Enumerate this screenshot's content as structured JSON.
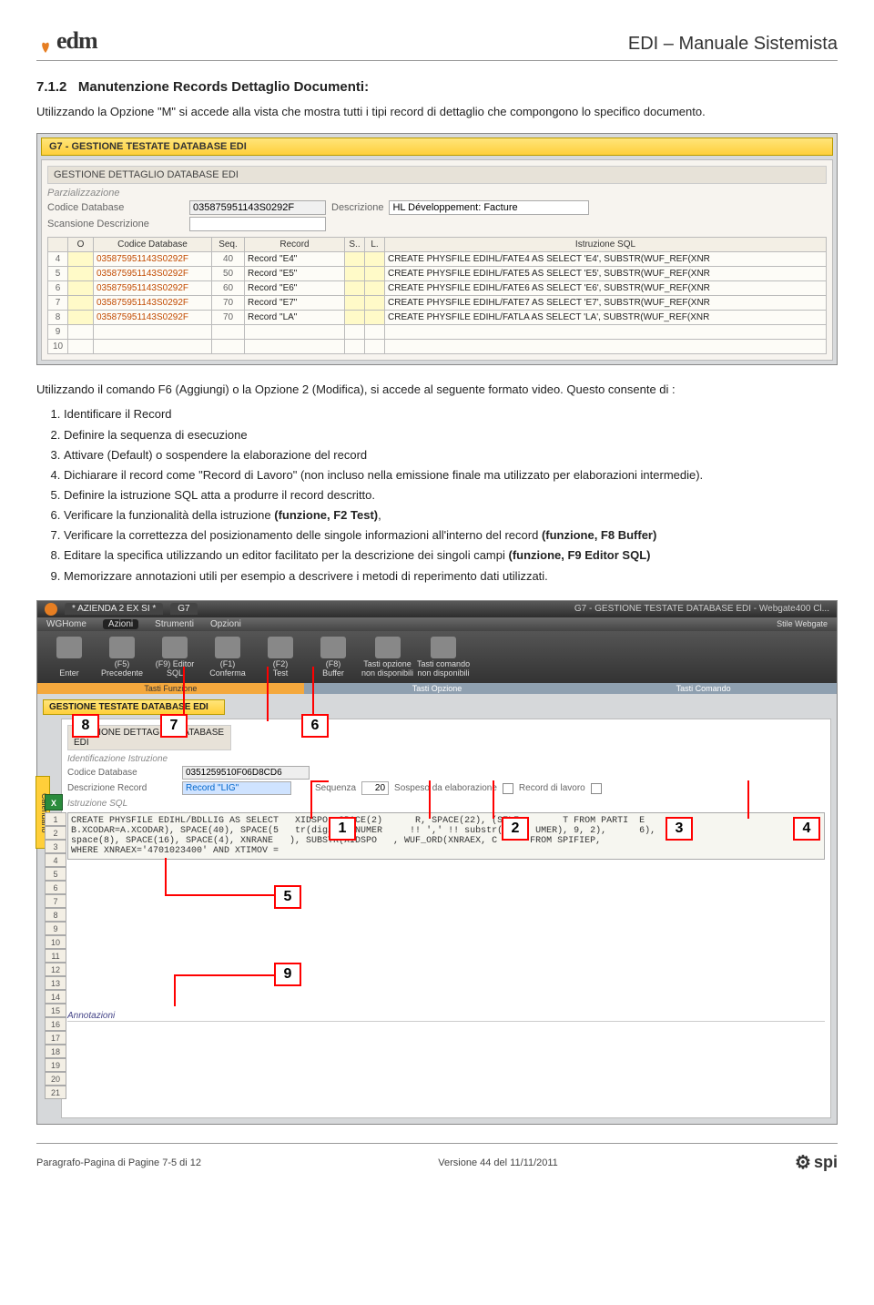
{
  "header": {
    "brand": "edm",
    "doc_title": "EDI – Manuale Sistemista"
  },
  "section": {
    "number": "7.1.2",
    "title": "Manutenzione Records Dettaglio Documenti:",
    "intro": "Utilizzando la Opzione \"M\" si accede alla vista che mostra tutti i tipi record di dettaglio che compongono lo specifico documento."
  },
  "ss1": {
    "titlebar": "G7 - GESTIONE TESTATE DATABASE EDI",
    "subtitle": "GESTIONE DETTAGLIO DATABASE EDI",
    "group_label": "Parzializzazione",
    "codice_label": "Codice Database",
    "codice_value": "035875951143S0292F",
    "descr_label": "Descrizione",
    "descr_value": "HL Développement: Facture",
    "scan_label": "Scansione Descrizione",
    "cols": [
      "",
      "O",
      "Codice Database",
      "Seq.",
      "Record",
      "S..",
      "L.",
      "Istruzione SQL"
    ],
    "rows": [
      {
        "n": "4",
        "cd": "035875951143S0292F",
        "seq": "40",
        "rec": "Record \"E4\"",
        "sql": "CREATE PHYSFILE EDIHL/FATE4 AS SELECT 'E4', SUBSTR(WUF_REF(XNR"
      },
      {
        "n": "5",
        "cd": "035875951143S0292F",
        "seq": "50",
        "rec": "Record \"E5\"",
        "sql": "CREATE PHYSFILE EDIHL/FATE5 AS SELECT 'E5', SUBSTR(WUF_REF(XNR"
      },
      {
        "n": "6",
        "cd": "035875951143S0292F",
        "seq": "60",
        "rec": "Record \"E6\"",
        "sql": "CREATE PHYSFILE EDIHL/FATE6 AS SELECT 'E6', SUBSTR(WUF_REF(XNR"
      },
      {
        "n": "7",
        "cd": "035875951143S0292F",
        "seq": "70",
        "rec": "Record \"E7\"",
        "sql": "CREATE PHYSFILE EDIHL/FATE7 AS SELECT 'E7', SUBSTR(WUF_REF(XNR"
      },
      {
        "n": "8",
        "cd": "035875951143S0292F",
        "seq": "70",
        "rec": "Record \"LA\"",
        "sql": "CREATE PHYSFILE EDIHL/FATLA AS SELECT 'LA', SUBSTR(WUF_REF(XNR"
      }
    ]
  },
  "midtext": "Utilizzando il comando F6 (Aggiungi) o la Opzione 2 (Modifica), si accede al seguente formato video. Questo consente di :",
  "steps": [
    "Identificare il Record",
    "Definire la sequenza di esecuzione",
    "Attivare (Default) o sospendere la elaborazione del record",
    "Dichiarare il record come \"Record di Lavoro\" (non incluso nella emissione finale ma utilizzato per elaborazioni intermedie).",
    "Definire la istruzione SQL atta a produrre il record descritto.",
    "Verificare la funzionalità della istruzione (funzione, F2 Test),",
    "Verificare la correttezza del posizionamento delle singole informazioni all'interno del record (funzione, F8 Buffer)",
    "Editare la specifica utilizzando un editor facilitato per la descrizione dei singoli campi (funzione, F9 Editor SQL)",
    "Memorizzare annotazioni utili per esempio a descrivere i metodi di reperimento dati utilizzati."
  ],
  "ss2": {
    "window_tab": "* AZIENDA 2 EX SI *",
    "app_name": "G7",
    "window_title": "G7 - GESTIONE TESTATE DATABASE EDI - Webgate400 Cl...",
    "right_ctl": "Stile Webgate",
    "menus": [
      "WGHome",
      "Azioni",
      "Strumenti",
      "Opzioni"
    ],
    "toolbar": [
      {
        "line1": "",
        "line2": "Enter"
      },
      {
        "line1": "(F5)",
        "line2": "Precedente"
      },
      {
        "line1": "(F9) Editor",
        "line2": "SQL"
      },
      {
        "line1": "(F1)",
        "line2": "Conferma"
      },
      {
        "line1": "(F2)",
        "line2": "Test"
      },
      {
        "line1": "(F8)",
        "line2": "Buffer"
      },
      {
        "line1": "Tasti opzione",
        "line2": "non disponibili"
      },
      {
        "line1": "Tasti comando",
        "line2": "non disponibili"
      }
    ],
    "ribbon_labels": [
      "Tasti Funzione",
      "Tasti Opzione",
      "Tasti Comando"
    ],
    "calendar_tab": "Calendario",
    "panel1": "GESTIONE TESTATE DATABASE EDI",
    "panel2": "GESTIONE DETTAGLIO DATABASE EDI",
    "ident": "Identificazione Istruzione",
    "codice_label": "Codice Database",
    "codice_value": "0351259510F06D8CD6",
    "descr_label": "Descrizione Record",
    "descr_value": "Record \"LIG\"",
    "seq_label": "Sequenza",
    "seq_value": "20",
    "sospeso_label": "Sospeso da elaborazione",
    "lavoro_label": "Record di lavoro",
    "sql_label": "Istruzione SQL",
    "sql_text": "CREATE PHYSFILE EDIHL/BDLLIG AS SELECT   XIDSPO, SPACE(2)      R, SPACE(22), (SELE        T FROM PARTI  E\nB.XCODAR=A.XCODAR), SPACE(40), SPACE(5   tr(digits(XNUMER     !! ',' !! substr(d     UMER), 9, 2),      6),\nspace(8), SPACE(16), SPACE(4), XNRANE   ), SUBSTR(XIDSPO   , WUF_ORD(XNRAEX, C      FROM SPIFIEP,\nWHERE XNRAEX='4701023400' AND XTIMOV =",
    "annot_label": "Annotazioni",
    "xls": "X",
    "callouts": {
      "c1": "1",
      "c2": "2",
      "c3": "3",
      "c4": "4",
      "c5": "5",
      "c6": "6",
      "c7": "7",
      "c8": "8",
      "c9": "9"
    }
  },
  "footer": {
    "left": "Paragrafo-Pagina di Pagine 7-5 di 12",
    "center": "Versione 44 del 11/11/2011",
    "brand": "spi"
  }
}
